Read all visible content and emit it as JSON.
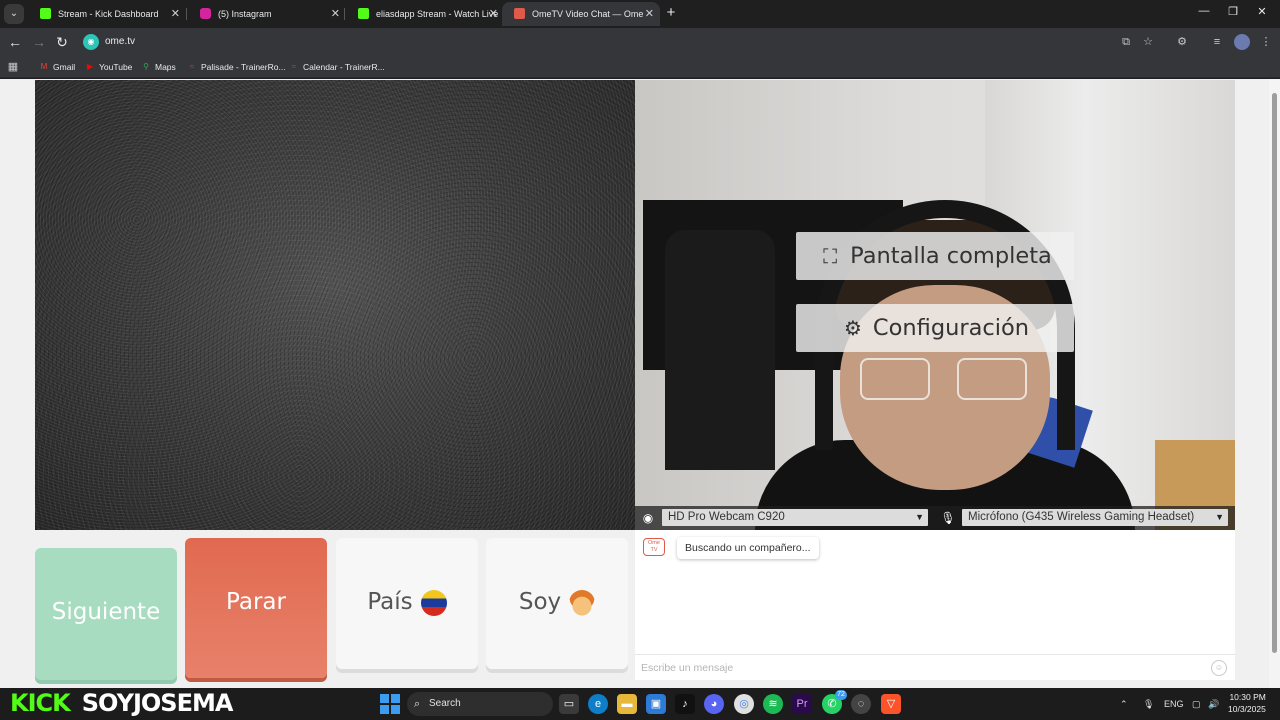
{
  "browser": {
    "tabs": [
      {
        "title": "Stream - Kick Dashboard",
        "favicon": "kick-icon",
        "color": "#53fc18",
        "active": false
      },
      {
        "title": "(5) Instagram",
        "favicon": "instagram-icon",
        "color": "#d6249f",
        "active": false
      },
      {
        "title": "eliasdapp Stream - Watch Live",
        "favicon": "kick-icon",
        "color": "#53fc18",
        "active": false
      },
      {
        "title": "OmeTV Video Chat — Ome",
        "favicon": "ometv-icon",
        "color": "#e05a4a",
        "active": true
      }
    ],
    "address": "ome.tv",
    "bookmarks": [
      {
        "label": "Gmail",
        "icon": "gmail-icon",
        "color": "#ea4335"
      },
      {
        "label": "YouTube",
        "icon": "youtube-icon",
        "color": "#ff0000"
      },
      {
        "label": "Maps",
        "icon": "maps-icon",
        "color": "#34a853"
      },
      {
        "label": "Palisade - TrainerRo...",
        "icon": "trainer-icon",
        "color": "#d03a2b"
      },
      {
        "label": "Calendar - TrainerR...",
        "icon": "trainer-icon",
        "color": "#d03a2b"
      }
    ]
  },
  "video": {
    "overlay": {
      "fullscreen_label": "Pantalla completa",
      "settings_label": "Configuración"
    },
    "camera_label": "HD Pro Webcam C920",
    "microphone_label": "Micrófono (G435 Wireless Gaming Headset)"
  },
  "controls": {
    "next_label": "Siguiente",
    "stop_label": "Parar",
    "country_label": "País",
    "country_flag": "venezuela-flag",
    "gender_label": "Soy",
    "gender_icon": "boy-emoji"
  },
  "chat": {
    "logo_text": "Ome TV",
    "status_message": "Buscando un compañero...",
    "input_placeholder": "Escribe un mensaje"
  },
  "stream_overlay": {
    "platform": "KICK",
    "channel": "SOYJOSEMA"
  },
  "taskbar": {
    "search_label": "Search",
    "whatsapp_badge": "72",
    "language": "ENG",
    "time": "10:30 PM",
    "date": "10/3/2025"
  },
  "colors": {
    "next": "#a7dcc0",
    "stop": "#e06a50",
    "kick_green": "#53fc18",
    "ome_red": "#e05a4a"
  }
}
